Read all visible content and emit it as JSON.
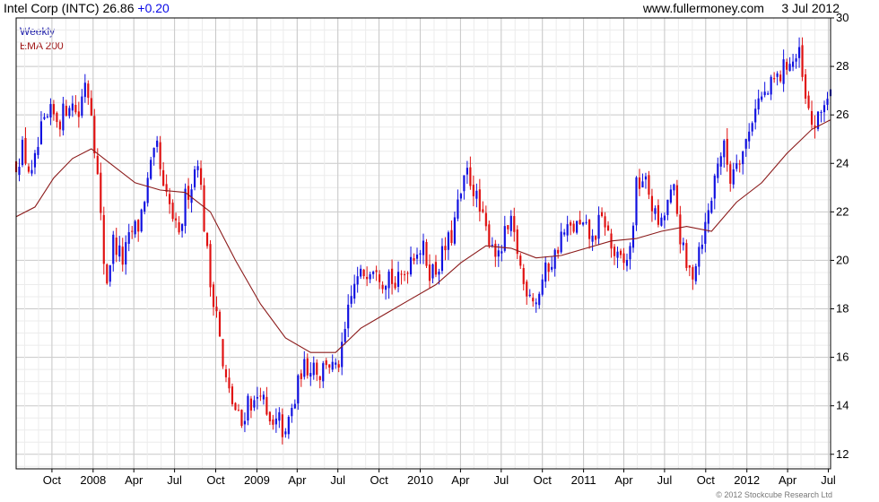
{
  "header": {
    "title": "Intel Corp (INTC) 26.86",
    "change": "+0.20",
    "website": "www.fullermoney.com",
    "date": "3 Jul 2012"
  },
  "footer": {
    "copyright": "© 2012 Stockcube Research Ltd"
  },
  "colors": {
    "up": "#1010e0",
    "down": "#e01010",
    "ema": "#8b1a1a",
    "grid": "#c8c8c8",
    "frame": "#000000"
  },
  "chart_data": {
    "type": "candlestick",
    "title": "Intel Corp (INTC) 26.86 +0.20",
    "period": "Weekly",
    "series": [
      {
        "name": "Weekly",
        "color": "#1010e0"
      },
      {
        "name": "EMA 200",
        "color": "#8b1a1a"
      }
    ],
    "ylim": [
      11.4,
      30
    ],
    "yticks": [
      12,
      14,
      16,
      18,
      20,
      22,
      24,
      26,
      28,
      30
    ],
    "x_start": "2007-07-13",
    "x_end": "2012-07-06",
    "x_ticks": [
      {
        "label": "Oct",
        "date": "2007-10-01"
      },
      {
        "label": "2008",
        "date": "2008-01-01"
      },
      {
        "label": "Apr",
        "date": "2008-04-01"
      },
      {
        "label": "Jul",
        "date": "2008-07-01"
      },
      {
        "label": "Oct",
        "date": "2008-10-01"
      },
      {
        "label": "2009",
        "date": "2009-01-01"
      },
      {
        "label": "Apr",
        "date": "2009-04-01"
      },
      {
        "label": "Jul",
        "date": "2009-07-01"
      },
      {
        "label": "Oct",
        "date": "2009-10-01"
      },
      {
        "label": "2010",
        "date": "2010-01-01"
      },
      {
        "label": "Apr",
        "date": "2010-04-01"
      },
      {
        "label": "Jul",
        "date": "2010-07-01"
      },
      {
        "label": "Oct",
        "date": "2010-10-01"
      },
      {
        "label": "2011",
        "date": "2011-01-01"
      },
      {
        "label": "Apr",
        "date": "2011-04-01"
      },
      {
        "label": "Jul",
        "date": "2011-07-01"
      },
      {
        "label": "Oct",
        "date": "2011-10-01"
      },
      {
        "label": "2012",
        "date": "2012-01-01"
      },
      {
        "label": "Apr",
        "date": "2012-04-01"
      },
      {
        "label": "Jul",
        "date": "2012-07-01"
      }
    ],
    "price_path": [
      [
        "2007-07-13",
        24.0
      ],
      [
        "2007-07-27",
        24.6
      ],
      [
        "2007-08-17",
        23.4
      ],
      [
        "2007-09-07",
        25.3
      ],
      [
        "2007-09-28",
        26.0
      ],
      [
        "2007-10-19",
        25.8
      ],
      [
        "2007-11-09",
        26.6
      ],
      [
        "2007-11-30",
        26.0
      ],
      [
        "2007-12-14",
        27.5
      ],
      [
        "2007-12-28",
        26.3
      ],
      [
        "2008-01-11",
        23.4
      ],
      [
        "2008-01-25",
        20.0
      ],
      [
        "2008-02-01",
        19.2
      ],
      [
        "2008-02-15",
        20.8
      ],
      [
        "2008-03-07",
        20.0
      ],
      [
        "2008-03-28",
        21.2
      ],
      [
        "2008-04-11",
        21.4
      ],
      [
        "2008-04-25",
        22.6
      ],
      [
        "2008-05-09",
        23.8
      ],
      [
        "2008-05-23",
        24.6
      ],
      [
        "2008-06-06",
        22.8
      ],
      [
        "2008-06-20",
        22.2
      ],
      [
        "2008-07-11",
        20.8
      ],
      [
        "2008-07-25",
        22.6
      ],
      [
        "2008-08-08",
        23.2
      ],
      [
        "2008-08-22",
        24.3
      ],
      [
        "2008-09-05",
        21.5
      ],
      [
        "2008-09-19",
        19.0
      ],
      [
        "2008-10-03",
        18.0
      ],
      [
        "2008-10-17",
        15.5
      ],
      [
        "2008-10-31",
        14.5
      ],
      [
        "2008-11-14",
        13.8
      ],
      [
        "2008-11-28",
        13.2
      ],
      [
        "2008-12-12",
        14.3
      ],
      [
        "2008-12-26",
        14.0
      ],
      [
        "2009-01-09",
        14.8
      ],
      [
        "2009-01-23",
        13.4
      ],
      [
        "2009-02-06",
        13.0
      ],
      [
        "2009-02-20",
        13.4
      ],
      [
        "2009-03-06",
        12.6
      ],
      [
        "2009-03-13",
        13.4
      ],
      [
        "2009-03-27",
        14.2
      ],
      [
        "2009-04-10",
        15.5
      ],
      [
        "2009-04-24",
        15.6
      ],
      [
        "2009-05-08",
        15.8
      ],
      [
        "2009-05-22",
        15.3
      ],
      [
        "2009-06-05",
        15.9
      ],
      [
        "2009-06-26",
        15.4
      ],
      [
        "2009-07-10",
        16.2
      ],
      [
        "2009-07-24",
        17.8
      ],
      [
        "2009-08-07",
        19.0
      ],
      [
        "2009-08-28",
        19.5
      ],
      [
        "2009-09-11",
        19.8
      ],
      [
        "2009-09-25",
        19.9
      ],
      [
        "2009-10-09",
        19.2
      ],
      [
        "2009-10-23",
        19.5
      ],
      [
        "2009-11-06",
        18.9
      ],
      [
        "2009-11-27",
        19.5
      ],
      [
        "2009-12-11",
        20.2
      ],
      [
        "2009-12-25",
        20.5
      ],
      [
        "2010-01-08",
        20.4
      ],
      [
        "2010-01-22",
        19.6
      ],
      [
        "2010-02-05",
        19.6
      ],
      [
        "2010-02-26",
        20.5
      ],
      [
        "2010-03-12",
        21.0
      ],
      [
        "2010-03-26",
        22.2
      ],
      [
        "2010-04-16",
        23.6
      ],
      [
        "2010-04-30",
        23.0
      ],
      [
        "2010-05-14",
        22.0
      ],
      [
        "2010-05-28",
        21.2
      ],
      [
        "2010-06-11",
        20.8
      ],
      [
        "2010-06-25",
        20.0
      ],
      [
        "2010-07-09",
        21.0
      ],
      [
        "2010-07-23",
        21.4
      ],
      [
        "2010-08-06",
        20.4
      ],
      [
        "2010-08-20",
        19.0
      ],
      [
        "2010-09-03",
        18.8
      ],
      [
        "2010-09-17",
        18.3
      ],
      [
        "2010-10-01",
        19.2
      ],
      [
        "2010-10-15",
        19.8
      ],
      [
        "2010-10-29",
        20.2
      ],
      [
        "2010-11-12",
        21.0
      ],
      [
        "2010-11-26",
        21.2
      ],
      [
        "2010-12-17",
        21.4
      ],
      [
        "2011-01-07",
        21.2
      ],
      [
        "2011-01-21",
        20.8
      ],
      [
        "2011-02-04",
        21.5
      ],
      [
        "2011-02-18",
        21.6
      ],
      [
        "2011-03-04",
        20.5
      ],
      [
        "2011-03-18",
        20.0
      ],
      [
        "2011-04-01",
        19.8
      ],
      [
        "2011-04-15",
        20.4
      ],
      [
        "2011-04-29",
        23.0
      ],
      [
        "2011-05-13",
        23.4
      ],
      [
        "2011-05-27",
        22.8
      ],
      [
        "2011-06-10",
        21.8
      ],
      [
        "2011-06-24",
        21.4
      ],
      [
        "2011-07-08",
        22.4
      ],
      [
        "2011-07-22",
        22.8
      ],
      [
        "2011-08-05",
        21.0
      ],
      [
        "2011-08-19",
        19.6
      ],
      [
        "2011-09-02",
        19.5
      ],
      [
        "2011-09-16",
        20.6
      ],
      [
        "2011-09-30",
        21.4
      ],
      [
        "2011-10-14",
        22.6
      ],
      [
        "2011-10-28",
        24.2
      ],
      [
        "2011-11-11",
        24.6
      ],
      [
        "2011-11-25",
        23.4
      ],
      [
        "2011-12-09",
        24.3
      ],
      [
        "2011-12-23",
        24.5
      ],
      [
        "2012-01-06",
        25.3
      ],
      [
        "2012-01-20",
        26.5
      ],
      [
        "2012-02-03",
        26.7
      ],
      [
        "2012-02-17",
        26.9
      ],
      [
        "2012-03-02",
        27.4
      ],
      [
        "2012-03-16",
        27.6
      ],
      [
        "2012-03-30",
        28.2
      ],
      [
        "2012-04-13",
        28.2
      ],
      [
        "2012-04-27",
        28.4
      ],
      [
        "2012-05-11",
        26.5
      ],
      [
        "2012-05-25",
        25.6
      ],
      [
        "2012-06-08",
        25.7
      ],
      [
        "2012-06-22",
        26.6
      ],
      [
        "2012-07-06",
        26.86
      ]
    ],
    "ema200_path": [
      [
        "2007-07-13",
        21.8
      ],
      [
        "2007-08-24",
        22.2
      ],
      [
        "2007-10-05",
        23.4
      ],
      [
        "2007-11-16",
        24.2
      ],
      [
        "2007-12-28",
        24.6
      ],
      [
        "2008-02-08",
        24.0
      ],
      [
        "2008-04-04",
        23.2
      ],
      [
        "2008-05-30",
        22.9
      ],
      [
        "2008-07-25",
        22.8
      ],
      [
        "2008-09-19",
        22.0
      ],
      [
        "2008-11-14",
        20.0
      ],
      [
        "2009-01-09",
        18.2
      ],
      [
        "2009-03-06",
        16.8
      ],
      [
        "2009-05-01",
        16.2
      ],
      [
        "2009-06-26",
        16.2
      ],
      [
        "2009-08-21",
        17.2
      ],
      [
        "2009-10-16",
        17.8
      ],
      [
        "2009-12-11",
        18.4
      ],
      [
        "2010-02-05",
        19.0
      ],
      [
        "2010-04-02",
        19.9
      ],
      [
        "2010-05-28",
        20.6
      ],
      [
        "2010-07-23",
        20.5
      ],
      [
        "2010-09-17",
        20.1
      ],
      [
        "2010-11-12",
        20.2
      ],
      [
        "2011-01-07",
        20.5
      ],
      [
        "2011-03-04",
        20.8
      ],
      [
        "2011-04-29",
        20.9
      ],
      [
        "2011-06-24",
        21.2
      ],
      [
        "2011-08-19",
        21.4
      ],
      [
        "2011-10-14",
        21.2
      ],
      [
        "2011-12-09",
        22.4
      ],
      [
        "2012-02-03",
        23.2
      ],
      [
        "2012-03-30",
        24.4
      ],
      [
        "2012-05-25",
        25.4
      ],
      [
        "2012-07-06",
        25.8
      ]
    ]
  }
}
